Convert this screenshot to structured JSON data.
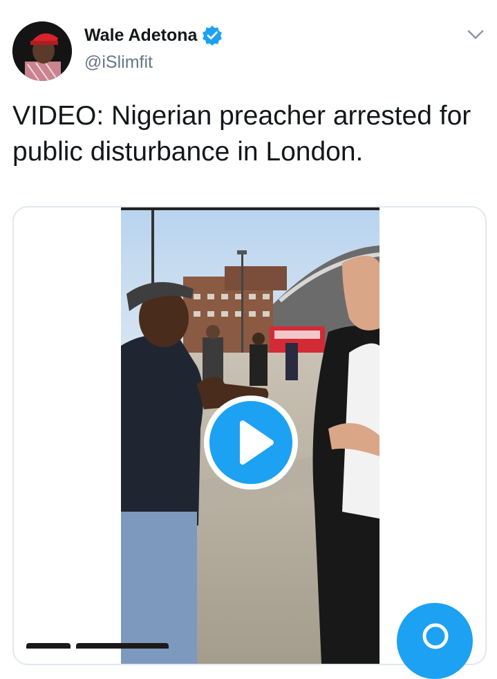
{
  "author": {
    "name": "Wale Adetona",
    "handle": "@iSlimfit",
    "verified": true,
    "avatar_icon": "profile-photo"
  },
  "tweet": {
    "text": "VIDEO: Nigerian preacher arrested for public disturbance in London."
  },
  "media": {
    "type": "video",
    "play_icon": "play-icon"
  },
  "icons": {
    "menu": "chevron-down-icon",
    "verified": "verified-badge-icon",
    "compose": "compose-icon"
  },
  "colors": {
    "accent": "#1da1f2",
    "text": "#14171a",
    "secondary": "#657786",
    "border": "#e1e8ed"
  }
}
